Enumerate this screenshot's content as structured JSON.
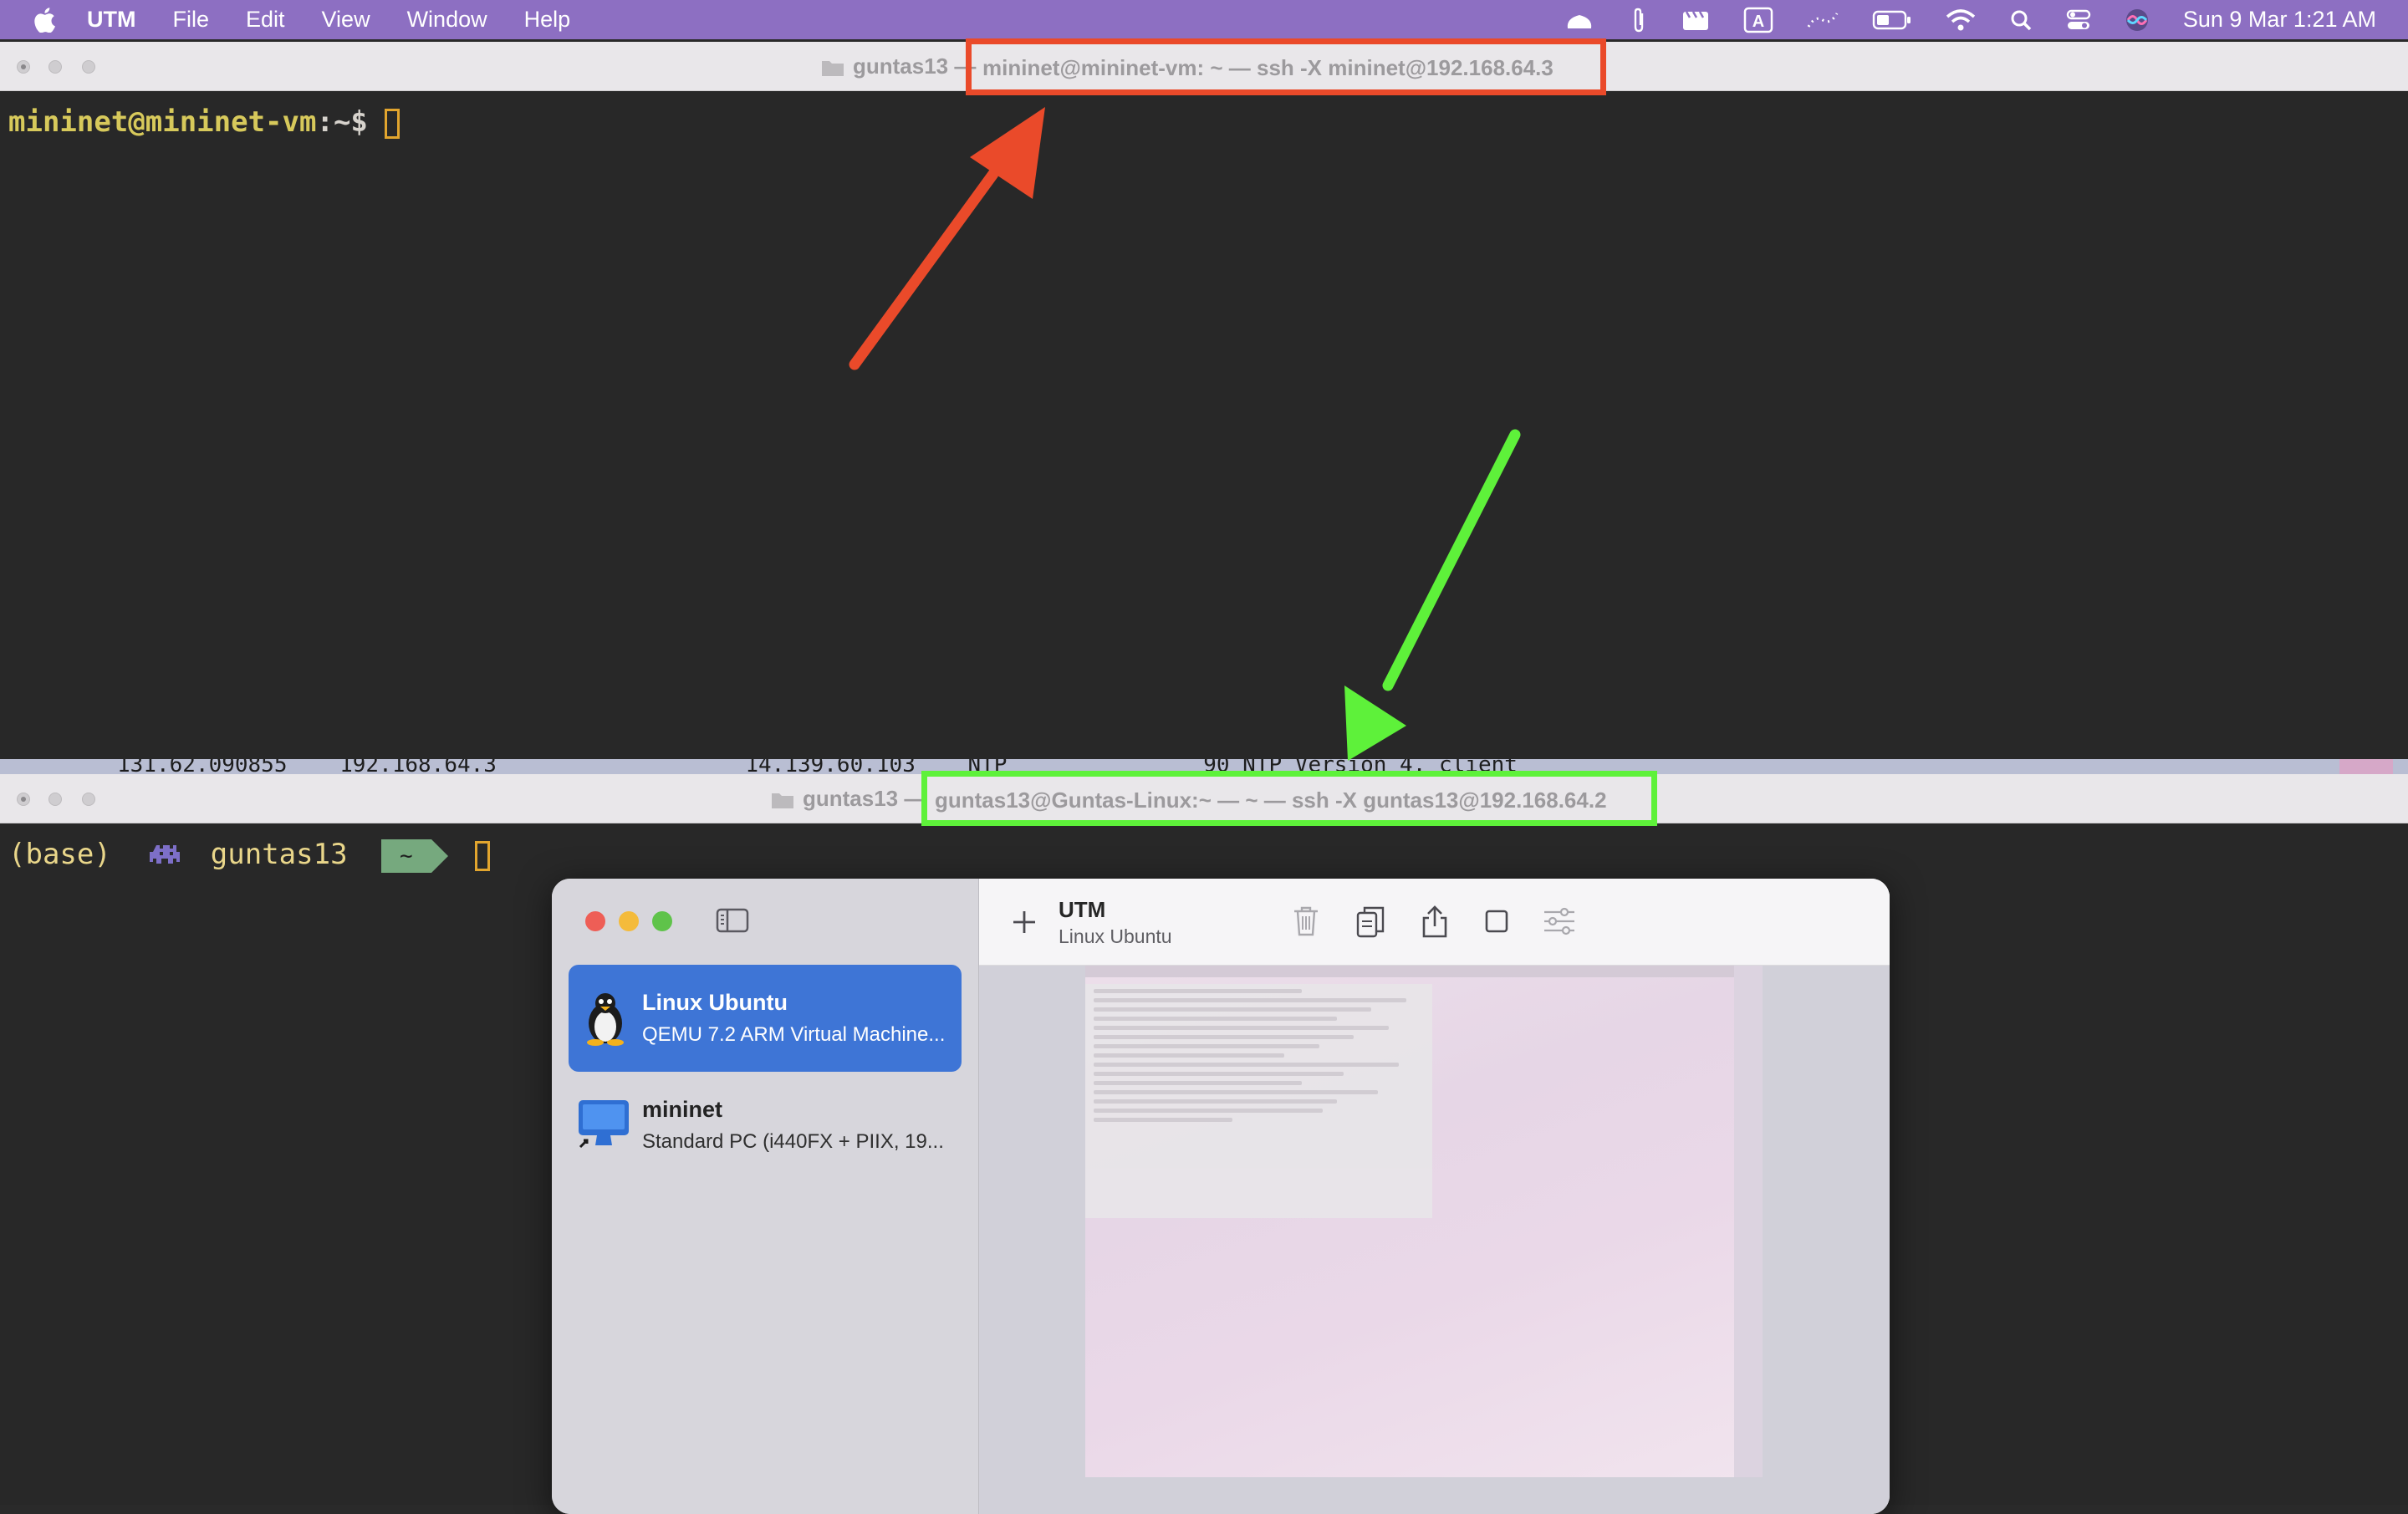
{
  "menubar": {
    "app_name": "UTM",
    "items": [
      "File",
      "Edit",
      "View",
      "Window",
      "Help"
    ],
    "clock": "Sun 9 Mar  1:21 AM",
    "status_icons": [
      "cloud-icon",
      "paperclip-icon",
      "clapper-icon",
      "input-source-icon",
      "dotted-wave-icon",
      "battery-icon",
      "wifi-icon",
      "search-icon",
      "control-center-icon",
      "siri-icon"
    ]
  },
  "terminal_top": {
    "title_prefix": "guntas13 —",
    "title_highlighted": "mininet@mininet-vm: ~ — ssh -X mininet@192.168.64.3",
    "prompt_user_host": "mininet@mininet-vm",
    "prompt_path": ":~$",
    "highlight_color": "#ea4a2a"
  },
  "background_line": {
    "text": "131.62.090855    192.168.64.3                   14.139.60.103    NTP               90 NTP Version 4, client"
  },
  "terminal_bottom": {
    "title_prefix": "guntas13 —",
    "title_highlighted": "guntas13@Guntas-Linux:~ — ~ — ssh -X guntas13@192.168.64.2",
    "prompt_env": "(base)",
    "prompt_user": "guntas13",
    "prompt_path": "~",
    "highlight_color": "#5ef13a"
  },
  "utm": {
    "title": "UTM",
    "subtitle": "Linux Ubuntu",
    "vms": [
      {
        "name": "Linux Ubuntu",
        "description": "QEMU 7.2 ARM Virtual Machine...",
        "selected": true
      },
      {
        "name": "mininet",
        "description": "Standard PC (i440FX + PIIX, 19...",
        "selected": false
      }
    ]
  }
}
